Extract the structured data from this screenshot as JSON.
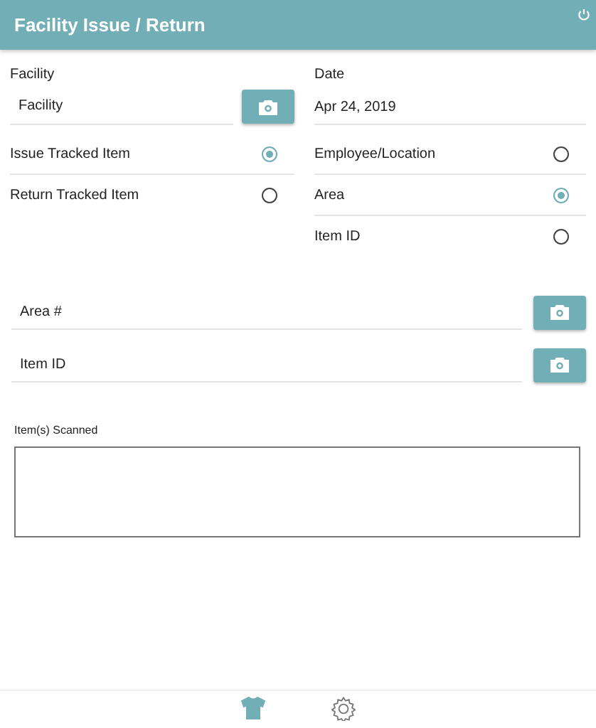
{
  "header": {
    "title": "Facility Issue / Return"
  },
  "facility": {
    "label": "Facility",
    "placeholder": "Facility"
  },
  "date": {
    "label": "Date",
    "value": "Apr 24, 2019"
  },
  "mode_options": [
    {
      "label": "Issue Tracked Item",
      "selected": true
    },
    {
      "label": "Return Tracked Item",
      "selected": false
    }
  ],
  "target_options": [
    {
      "label": "Employee/Location",
      "selected": false
    },
    {
      "label": "Area",
      "selected": true
    },
    {
      "label": "Item ID",
      "selected": false
    }
  ],
  "scan_fields": [
    {
      "placeholder": "Area #"
    },
    {
      "placeholder": "Item ID"
    }
  ],
  "scanned": {
    "label": "Item(s) Scanned"
  },
  "bottom_nav": [
    {
      "kind": "shirt",
      "selected": true
    },
    {
      "kind": "gear",
      "selected": false
    }
  ]
}
